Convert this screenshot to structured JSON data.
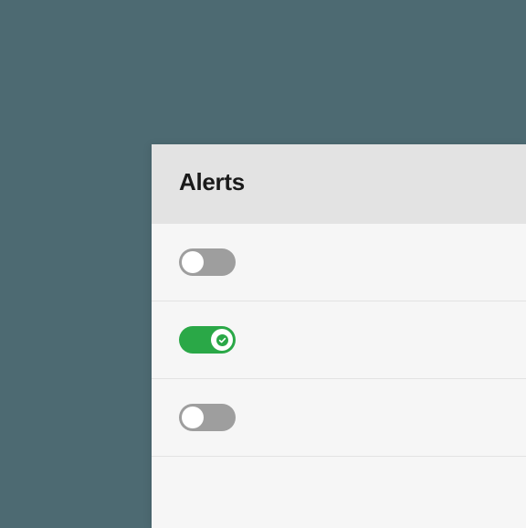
{
  "header": {
    "title": "Alerts"
  },
  "rows": [
    {
      "enabled": false
    },
    {
      "enabled": true
    },
    {
      "enabled": false
    }
  ],
  "colors": {
    "on": "#2aa847",
    "off": "#9e9e9e"
  }
}
